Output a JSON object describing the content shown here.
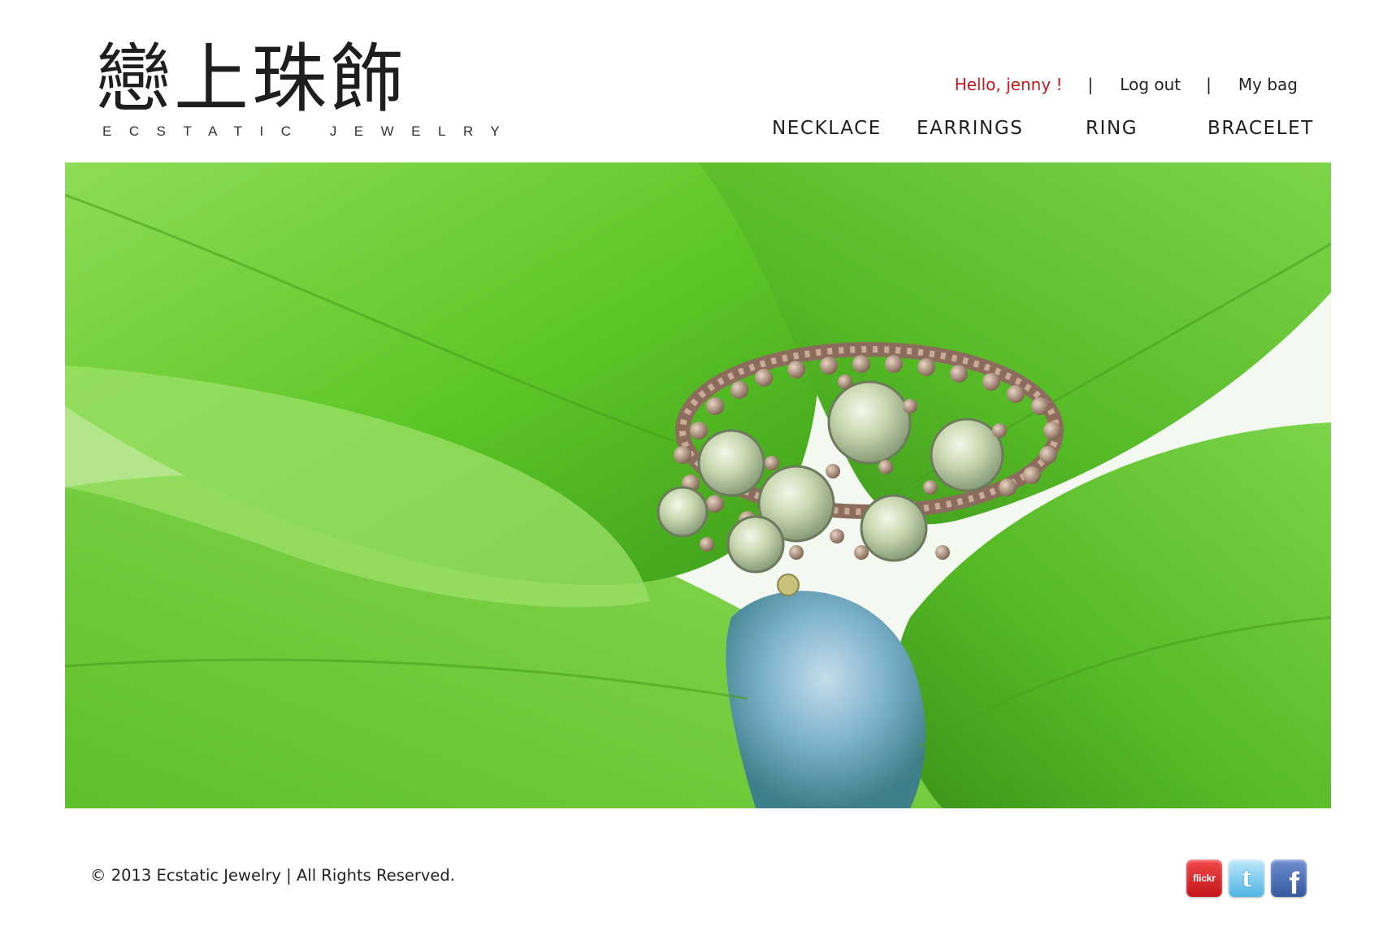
{
  "header": {
    "logo_cn": "戀上珠飾",
    "logo_en": "ECSTATIC JEWELRY"
  },
  "user_bar": {
    "greeting": "Hello, jenny !",
    "separator": "|",
    "logout_label": "Log out",
    "bag_label": "My bag"
  },
  "nav": {
    "items": [
      {
        "label": "NECKLACE"
      },
      {
        "label": "EARRINGS"
      },
      {
        "label": "RING"
      },
      {
        "label": "BRACELET"
      }
    ]
  },
  "hero": {
    "subject": "beaded crystal ring on green leaves"
  },
  "footer": {
    "copyright": "© 2013 Ecstatic Jewelry | All Rights Reserved.",
    "social": [
      {
        "name": "flickr",
        "label": "flickr",
        "color": "#d9252a"
      },
      {
        "name": "twitter",
        "color": "#62bbe6"
      },
      {
        "name": "facebook",
        "color": "#3b5998"
      }
    ]
  },
  "colors": {
    "greeting": "#c4161c",
    "text": "#222222",
    "leaf": "#5fc22c"
  }
}
